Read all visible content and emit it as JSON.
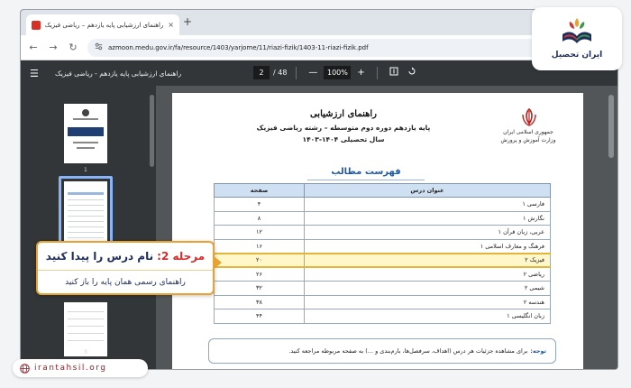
{
  "browser": {
    "tab_title": "راهنمای ارزشیابی پایه یازدهم – ریاضی فیزیک",
    "tab_close": "×",
    "new_tab": "+",
    "back": "←",
    "forward": "→",
    "reload": "↻",
    "url": "azmoon.medu.gov.ir/fa/resource/1403/yarjome/11/riazi-fizik/1403-11-riazi-fizik.pdf"
  },
  "pdf_toolbar": {
    "title": "راهنمای ارزشیابی پایه یازدهم - ریاضی فیزیک",
    "current_page": "2",
    "total_pages": "/ 48",
    "zoom_out": "—",
    "zoom": "100%",
    "zoom_in": "+"
  },
  "sidebar": {
    "thumb1_label": "1",
    "thumb3_label": "3"
  },
  "document": {
    "org_line1": "جمهوری اسلامی ایران",
    "org_line2": "وزارت آموزش و پرورش",
    "title": "راهنمای ارزشیابی",
    "subtitle": "پایه یازدهم دوره دوم متوسطه – رشته ریاضی فیزیک",
    "year": "سال تحصیلی ۱۴۰۴-۱۴۰۳",
    "toc_title": "فهرست مطالب",
    "table": {
      "header_title": "عنوان درس",
      "header_page": "صفحه",
      "rows": [
        {
          "title": "فارسی ۱",
          "page": "۴"
        },
        {
          "title": "نگارش ۱",
          "page": "۸"
        },
        {
          "title": "عربی، زبان قرآن ۱",
          "page": "۱۲"
        },
        {
          "title": "فرهنگ و معارف اسلامی ۱",
          "page": "۱۶"
        },
        {
          "title": "فیزیک ۲",
          "page": "۲۰"
        },
        {
          "title": "ریاضی ۲",
          "page": "۲۶"
        },
        {
          "title": "شیمی ۲",
          "page": "۳۲"
        },
        {
          "title": "هندسه ۲",
          "page": "۳۸"
        },
        {
          "title": "زبان انگلیسی ۱",
          "page": "۴۴"
        }
      ]
    },
    "note_label": "توجه:",
    "note_text": "برای مشاهده جزئیات هر درس (اهداف، سرفصل‌ها، بارم‌بندی و ...) به صفحه مربوطه مراجعه کنید."
  },
  "callout": {
    "step": "مرحله 2:",
    "step_text": "نام درس را پیدا کنید",
    "description": "راهنمای رسمی همان پایه را باز کنید"
  },
  "logo": {
    "text": "ایران تحصیل"
  },
  "site": {
    "text": "irantahsil.org"
  },
  "colors": {
    "accent_orange": "#e7a235",
    "step_red": "#d32c2c",
    "brand_navy": "#1f2d5c",
    "brand_red": "#9b1f2a",
    "toc_blue": "#1e5aa8"
  }
}
